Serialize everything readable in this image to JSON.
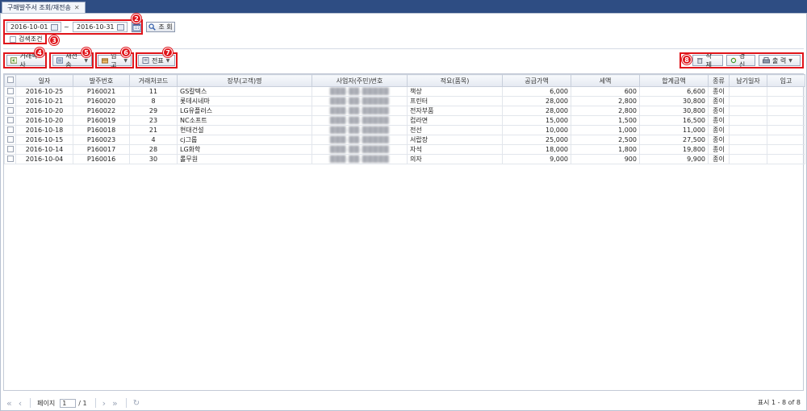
{
  "window": {
    "tab_title": "구매발주서 조회/재전송",
    "tab_close": "✕"
  },
  "filter": {
    "date_from": "2016-10-01",
    "date_to": "2016-10-31",
    "tilde": "~",
    "search_label": "조 회",
    "condition_label": "검색조건"
  },
  "badges": [
    "2",
    "3",
    "4",
    "5",
    "6",
    "7",
    "8"
  ],
  "toolbar": {
    "copy_label": "거래복사",
    "resend_label": "재전송",
    "receive_label": "입고",
    "slip_label": "전표",
    "delete_label": "삭 제",
    "update_label": "경 신",
    "print_label": "출 력"
  },
  "table": {
    "columns": [
      "일자",
      "발주번호",
      "거래처코드",
      "장부(고객)명",
      "사업자(주민)번호",
      "적요(품목)",
      "공급가액",
      "세액",
      "합계금액",
      "종류",
      "납기일자",
      "입고"
    ],
    "rows": [
      [
        "2016-10-25",
        "P160021",
        "11",
        "GS칼텍스",
        "",
        "책상",
        "6,000",
        "600",
        "6,600",
        "종이",
        "",
        ""
      ],
      [
        "2016-10-21",
        "P160020",
        "8",
        "롯데시네마",
        "",
        "프린터",
        "28,000",
        "2,800",
        "30,800",
        "종이",
        "",
        ""
      ],
      [
        "2016-10-20",
        "P160022",
        "29",
        "LG유플러스",
        "",
        "전자부품",
        "28,000",
        "2,800",
        "30,800",
        "종이",
        "",
        ""
      ],
      [
        "2016-10-20",
        "P160019",
        "23",
        "NC소프트",
        "",
        "컵라면",
        "15,000",
        "1,500",
        "16,500",
        "종이",
        "",
        ""
      ],
      [
        "2016-10-18",
        "P160018",
        "21",
        "현대건설",
        "",
        "전선",
        "10,000",
        "1,000",
        "11,000",
        "종이",
        "",
        ""
      ],
      [
        "2016-10-15",
        "P160023",
        "4",
        "cj그룹",
        "",
        "서랍장",
        "25,000",
        "2,500",
        "27,500",
        "종이",
        "",
        ""
      ],
      [
        "2016-10-14",
        "P160017",
        "28",
        "LG화학",
        "",
        "자석",
        "18,000",
        "1,800",
        "19,800",
        "종이",
        "",
        ""
      ],
      [
        "2016-10-04",
        "P160016",
        "30",
        "롤무원",
        "",
        "의자",
        "9,000",
        "900",
        "9,900",
        "종이",
        "",
        ""
      ]
    ]
  },
  "pager": {
    "page_label": "페이지",
    "page_value": "1",
    "page_total": "/ 1",
    "status": "표시 1 - 8 of 8"
  }
}
